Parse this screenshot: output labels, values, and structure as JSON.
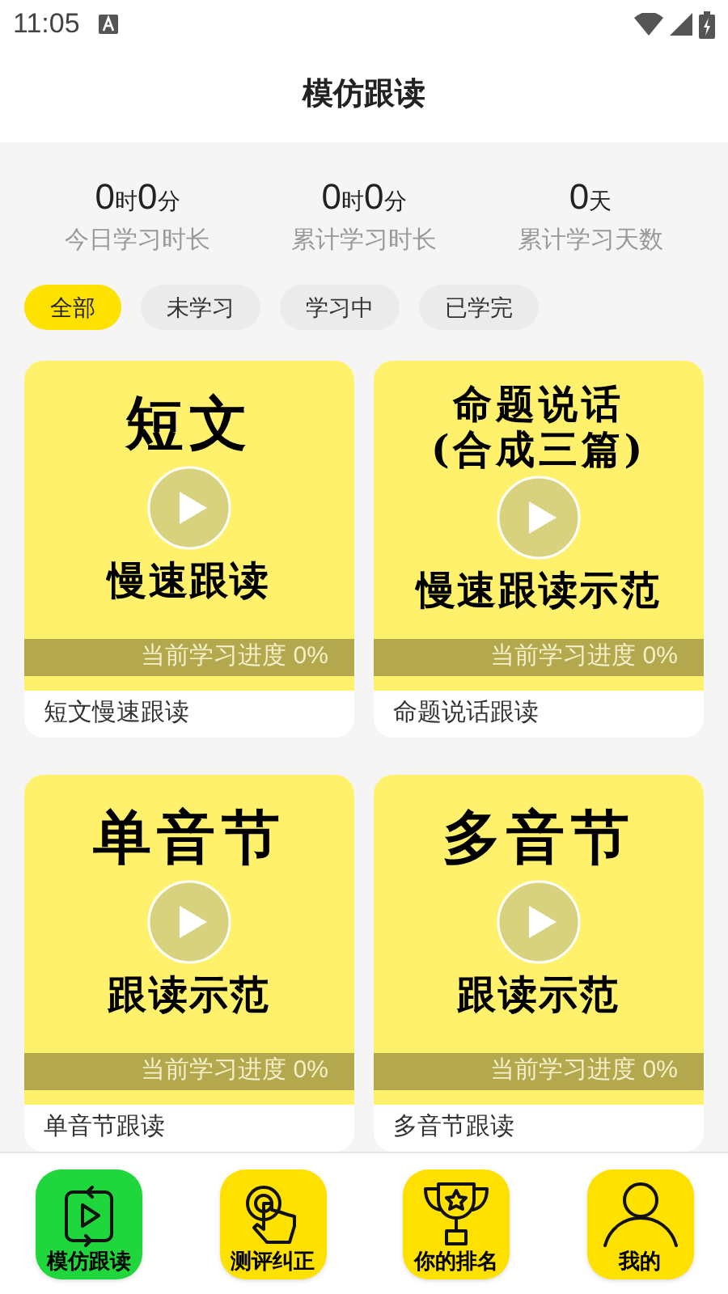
{
  "status_bar": {
    "time": "11:05"
  },
  "header": {
    "title": "模仿跟读"
  },
  "stats": [
    {
      "parts": [
        {
          "kind": "number",
          "text": "0"
        },
        {
          "kind": "unit",
          "text": "时"
        },
        {
          "kind": "number",
          "text": "0"
        },
        {
          "kind": "unit",
          "text": "分"
        }
      ],
      "label": "今日学习时长"
    },
    {
      "parts": [
        {
          "kind": "number",
          "text": "0"
        },
        {
          "kind": "unit",
          "text": "时"
        },
        {
          "kind": "number",
          "text": "0"
        },
        {
          "kind": "unit",
          "text": "分"
        }
      ],
      "label": "累计学习时长"
    },
    {
      "parts": [
        {
          "kind": "number",
          "text": "0"
        },
        {
          "kind": "unit",
          "text": "天"
        }
      ],
      "label": "累计学习天数"
    }
  ],
  "filters": [
    {
      "label": "全部",
      "selected": true
    },
    {
      "label": "未学习",
      "selected": false
    },
    {
      "label": "学习中",
      "selected": false
    },
    {
      "label": "已学完",
      "selected": false
    }
  ],
  "cards": [
    {
      "title_lines": [
        "短文"
      ],
      "subtitle": "慢速跟读",
      "progress": "当前学习进度 0%",
      "caption": "短文慢速跟读"
    },
    {
      "title_lines": [
        "命题说话",
        "(合成三篇)"
      ],
      "subtitle": "慢速跟读示范",
      "progress": "当前学习进度 0%",
      "caption": "命题说话跟读"
    },
    {
      "title_lines": [
        "单音节"
      ],
      "subtitle": "跟读示范",
      "progress": "当前学习进度 0%",
      "caption": "单音节跟读"
    },
    {
      "title_lines": [
        "多音节"
      ],
      "subtitle": "跟读示范",
      "progress": "当前学习进度 0%",
      "caption": "多音节跟读"
    }
  ],
  "nav": [
    {
      "kind": "follow",
      "label": "模仿跟读",
      "selected": true
    },
    {
      "kind": "touch",
      "label": "测评纠正",
      "selected": false
    },
    {
      "kind": "trophy",
      "label": "你的排名",
      "selected": false
    },
    {
      "kind": "person",
      "label": "我的",
      "selected": false
    }
  ]
}
